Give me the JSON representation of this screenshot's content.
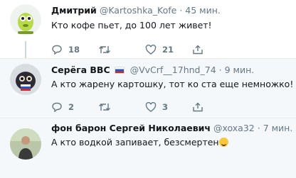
{
  "tweets": [
    {
      "name": "Дмитрий",
      "handle": "@Kartoshka_Kofe",
      "dot": "·",
      "time": "45 мин.",
      "text": "Кто кофе пьет, до 100 лет живет!",
      "reply_count": "18",
      "retweet_count": "",
      "like_count": "21"
    },
    {
      "name": "Серёга ВВС",
      "handle": "@VvCrf__17hnd_74",
      "dot": "·",
      "time": "9 мин.",
      "text": "А кто жарену картошку, тот ко ста еще немножко!",
      "reply_count": "2",
      "retweet_count": "",
      "like_count": "3"
    },
    {
      "name": "фон барон Сергей Николаевич",
      "handle": "@xoxa32",
      "dot": "·",
      "time": "7 мин.",
      "text": "А кто водкой запивает, безсмертен",
      "reply_count": "",
      "retweet_count": "",
      "like_count": ""
    }
  ],
  "icons": {
    "reply": "reply-icon",
    "retweet": "retweet-icon",
    "like": "heart-icon",
    "share": "share-icon",
    "flag": "russia-flag-icon",
    "emoji": "rolling-laughing-emoji"
  },
  "colors": {
    "icon_gray": "#657786",
    "highlight_bg": "#f5f8fa",
    "thread_line": "#ccd6dd"
  }
}
